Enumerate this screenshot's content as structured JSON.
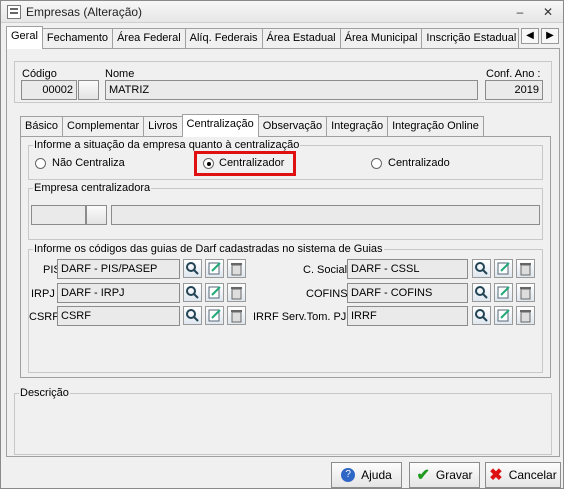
{
  "window": {
    "title": "Empresas (Alteração)",
    "minimize": "–",
    "close": "✕"
  },
  "main_tabs": [
    "Geral",
    "Fechamento",
    "Área Federal",
    "Alíq. Federais",
    "Área Estadual",
    "Área Municipal",
    "Inscrição Estadual S"
  ],
  "scroll": {
    "left": "◀",
    "right": "▶"
  },
  "header": {
    "codigo_label": "Código",
    "codigo_value": "00002",
    "nome_label": "Nome",
    "nome_value": "MATRIZ",
    "conf_label": "Conf. Ano :",
    "conf_value": "2019"
  },
  "sub_tabs": [
    "Básico",
    "Complementar",
    "Livros",
    "Centralização",
    "Observação",
    "Integração",
    "Integração Online"
  ],
  "centralizacao": {
    "group_title": "Informe a situação da empresa quanto à centralização",
    "options": [
      "Não Centraliza",
      "Centralizador",
      "Centralizado"
    ],
    "selected": "Centralizador",
    "highlight_color": "#e01010"
  },
  "empresa_centralizadora": {
    "title": "Empresa centralizadora",
    "code": "",
    "name": ""
  },
  "darf": {
    "title": "Informe os códigos das guias de Darf cadastradas no sistema de Guias",
    "left": [
      {
        "label": "PIS",
        "value": "DARF - PIS/PASEP"
      },
      {
        "label": "IRPJ",
        "value": "DARF - IRPJ"
      },
      {
        "label": "CSRF",
        "value": "CSRF"
      }
    ],
    "right": [
      {
        "label": "C. Social",
        "value": "DARF - CSSL"
      },
      {
        "label": "COFINS",
        "value": "DARF - COFINS"
      },
      {
        "label": "IRRF Serv.Tom. PJ",
        "value": "IRRF"
      }
    ]
  },
  "descricao": {
    "label": "Descrição",
    "value": ""
  },
  "buttons": {
    "ajuda": "Ajuda",
    "gravar": "Gravar",
    "cancelar": "Cancelar"
  }
}
